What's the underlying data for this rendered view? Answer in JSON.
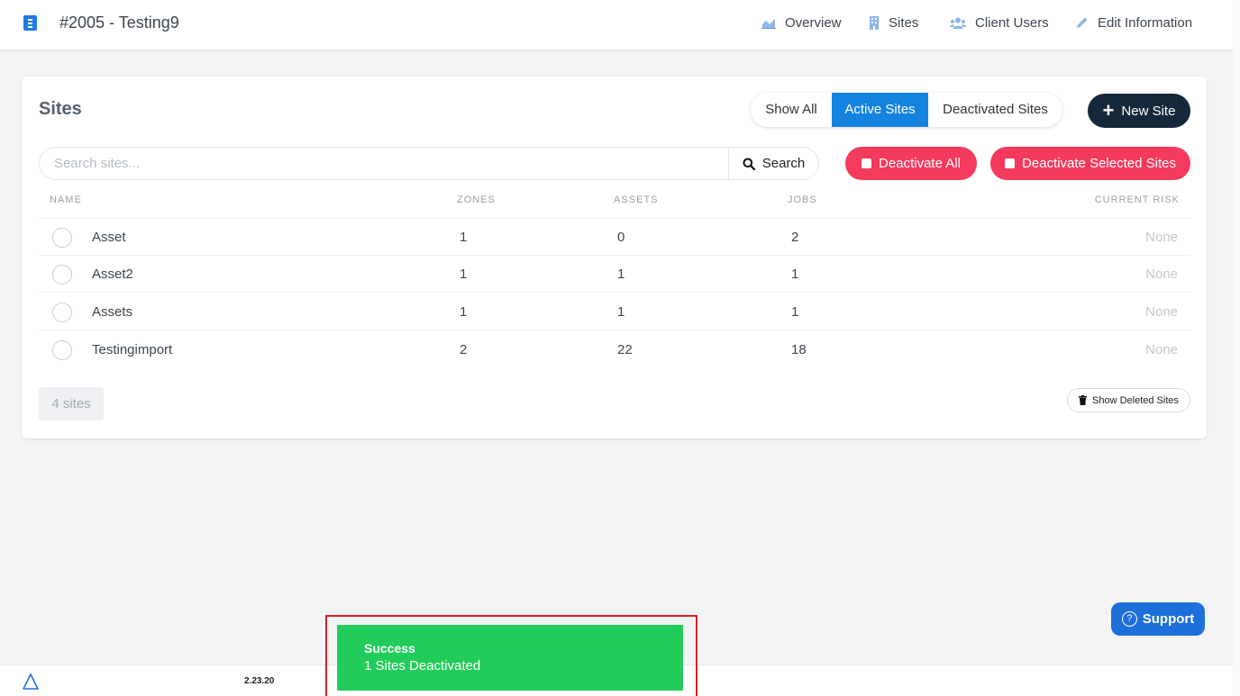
{
  "header": {
    "title": "#2005 - Testing9",
    "nav": {
      "overview": "Overview",
      "sites": "Sites",
      "client_users": "Client Users",
      "edit_information": "Edit Information"
    }
  },
  "card": {
    "title": "Sites",
    "filters": {
      "show_all": "Show All",
      "active_sites": "Active Sites",
      "deactivated_sites": "Deactivated Sites",
      "selected": "Active Sites"
    },
    "new_site_label": "New Site",
    "search": {
      "placeholder": "Search sites...",
      "value": "",
      "button_label": "Search"
    },
    "deactivate_all_label": "Deactivate All",
    "deactivate_selected_label": "Deactivate Selected Sites",
    "columns": {
      "name": "NAME",
      "zones": "ZONES",
      "assets": "ASSETS",
      "jobs": "JOBS",
      "current_risk": "CURRENT RISK"
    },
    "rows": [
      {
        "name": "Asset",
        "zones": "1",
        "assets": "0",
        "jobs": "2",
        "risk": "None"
      },
      {
        "name": "Asset2",
        "zones": "1",
        "assets": "1",
        "jobs": "1",
        "risk": "None"
      },
      {
        "name": "Assets",
        "zones": "1",
        "assets": "1",
        "jobs": "1",
        "risk": "None"
      },
      {
        "name": "Testingimport",
        "zones": "2",
        "assets": "22",
        "jobs": "18",
        "risk": "None"
      }
    ],
    "count_label": "4 sites",
    "show_deleted_label": "Show Deleted Sites"
  },
  "support_label": "Support",
  "footer": {
    "version": "2.23.20"
  },
  "toast": {
    "title": "Success",
    "message": "1 Sites Deactivated"
  },
  "colors": {
    "primary_blue": "#1483e0",
    "dark_navy": "#15283b",
    "danger_red": "#f43a5d",
    "success_green": "#22cc5b"
  },
  "icons": {
    "brand": "contact-book-icon",
    "overview": "area-chart-icon",
    "sites": "building-icon",
    "client_users": "users-icon",
    "edit_information": "pencil-icon",
    "search": "search-icon",
    "trash": "trash-icon",
    "support": "question-circle-icon",
    "footer_logo": "triangle-logo-icon"
  }
}
